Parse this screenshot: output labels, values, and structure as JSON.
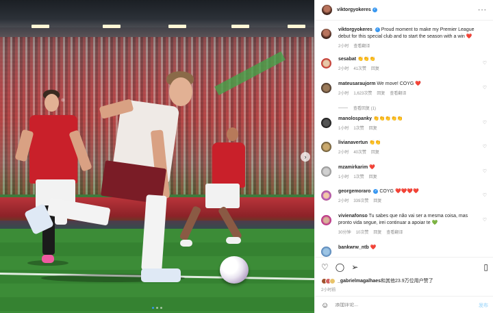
{
  "post": {
    "username": "viktorgyokeres",
    "verified_badge": "verified-icon",
    "more_label": "···"
  },
  "caption": {
    "username": "viktorgyokeres",
    "text": "Proud moment to make my Premier League debut for this special club and to start the season with a win",
    "emoji": "❤️",
    "time": "2小时",
    "translate": "查看翻译"
  },
  "comments": [
    {
      "username": "sesabat",
      "text": "👏👏👏",
      "time": "2小时",
      "likes": "41次赞",
      "reply": "回复"
    },
    {
      "username": "mateusaraujorm",
      "text": "We move! COYG",
      "emoji": "❤️",
      "time": "2小时",
      "likes": "1,623次赞",
      "reply": "回复",
      "translate": "查看翻译",
      "view_replies": "查看回复 (1)"
    },
    {
      "username": "manolospanky",
      "text": "👏👏👏👏👏",
      "time": "1小时",
      "likes": "1次赞",
      "reply": "回复"
    },
    {
      "username": "livianavertun",
      "text": "👏👏",
      "time": "2小时",
      "likes": "40次赞",
      "reply": "回复"
    },
    {
      "username": "mzamirkarim",
      "text": "",
      "emoji": "❤️",
      "time": "1小时",
      "likes": "1次赞",
      "reply": "回复"
    },
    {
      "username": "georgemoraro",
      "text": "COYG",
      "emoji": "❤️❤️❤️❤️",
      "time": "2小时",
      "likes": "339次赞",
      "reply": "回复"
    },
    {
      "username": "vivienafonso",
      "text": "Tu sabes que não vai ser a mesma coisa, mas pronto vida segue, irei continuar a apoiar te",
      "emoji": "💚",
      "time": "30分钟",
      "likes": "10次赞",
      "reply": "回复",
      "translate": "查看翻译"
    },
    {
      "username": "bankwrw_ntb",
      "text": "",
      "emoji": "❤️",
      "time": "",
      "likes": "",
      "reply": ""
    }
  ],
  "actions": {
    "like_icon": "heart-icon",
    "comment_icon": "comment-icon",
    "share_icon": "share-icon",
    "save_icon": "bookmark-icon"
  },
  "likes_summary": {
    "first_user": "_gabrielmagalhaes",
    "rest": "和其他23.9万位用户赞了"
  },
  "post_time": "2小时前",
  "add_comment": {
    "placeholder": "添加评论...",
    "post_label": "发布"
  },
  "colors": {
    "accent": "#3897f0",
    "heart": "#ed4956",
    "muted": "#8e8e8e"
  }
}
